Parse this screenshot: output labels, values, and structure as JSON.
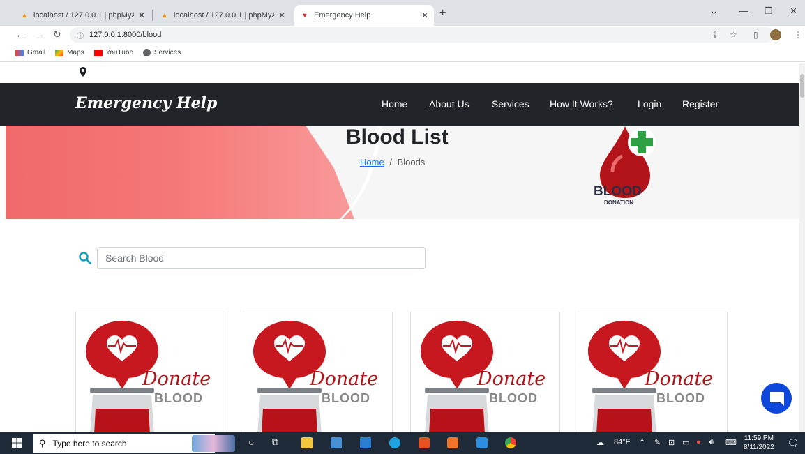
{
  "browser": {
    "tabs": [
      {
        "title": "localhost / 127.0.0.1 | phpMyAdm",
        "active": false
      },
      {
        "title": "localhost / 127.0.0.1 | phpMyAdm",
        "active": false
      },
      {
        "title": "Emergency Help",
        "active": true
      }
    ],
    "url": "127.0.0.1:8000/blood",
    "bookmarks": [
      "Gmail",
      "Maps",
      "YouTube",
      "Services"
    ]
  },
  "site": {
    "brand": "Emergency Help",
    "nav": [
      "Home",
      "About Us",
      "Services",
      "How It Works?",
      "Login",
      "Register"
    ]
  },
  "hero": {
    "title": "Blood List",
    "breadcrumb_home": "Home",
    "breadcrumb_sep": "/",
    "breadcrumb_current": "Bloods",
    "logo_text": "BLOOD",
    "logo_sub": "DONATION"
  },
  "search": {
    "placeholder": "Search Blood"
  },
  "cards": [
    {
      "donate": "Donate",
      "blood": "BLOOD"
    },
    {
      "donate": "Donate",
      "blood": "BLOOD"
    },
    {
      "donate": "Donate",
      "blood": "BLOOD"
    },
    {
      "donate": "Donate",
      "blood": "BLOOD"
    }
  ],
  "taskbar": {
    "search_placeholder": "Type here to search",
    "weather": "84°F",
    "time": "11:59 PM",
    "date": "8/11/2022"
  },
  "colors": {
    "navbar": "#212529",
    "accent_red": "#b3141a",
    "chat": "#0d47d9"
  }
}
